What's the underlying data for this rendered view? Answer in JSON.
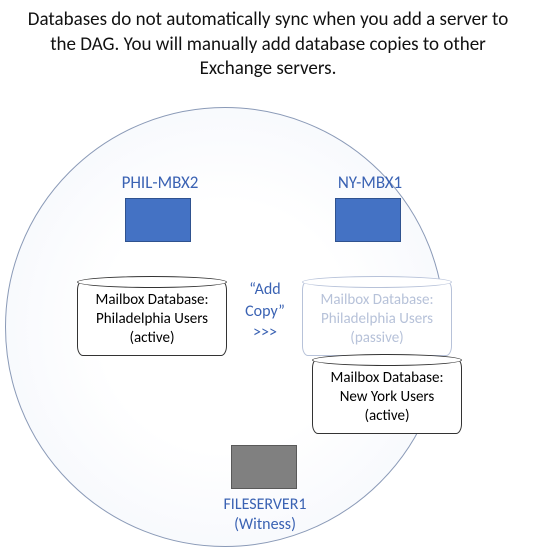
{
  "caption": "Databases do not automatically sync when you add a server to the DAG.  You will manually add database copies to other Exchange servers.",
  "servers": {
    "left": {
      "label": "PHIL-MBX2"
    },
    "right": {
      "label": "NY-MBX1"
    },
    "witness": {
      "label": "FILESERVER1",
      "role": "(Witness)"
    }
  },
  "databases": {
    "left_active": {
      "line1": "Mailbox Database:",
      "line2": "Philadelphia Users",
      "line3": "(active)"
    },
    "right_passive": {
      "line1": "Mailbox Database:",
      "line2": "Philadelphia Users",
      "line3": "(passive)"
    },
    "right_active": {
      "line1": "Mailbox Database:",
      "line2": "New York Users",
      "line3": "(active)"
    }
  },
  "addcopy": {
    "line1": "“Add",
    "line2": "Copy”",
    "line3": ">>>"
  }
}
